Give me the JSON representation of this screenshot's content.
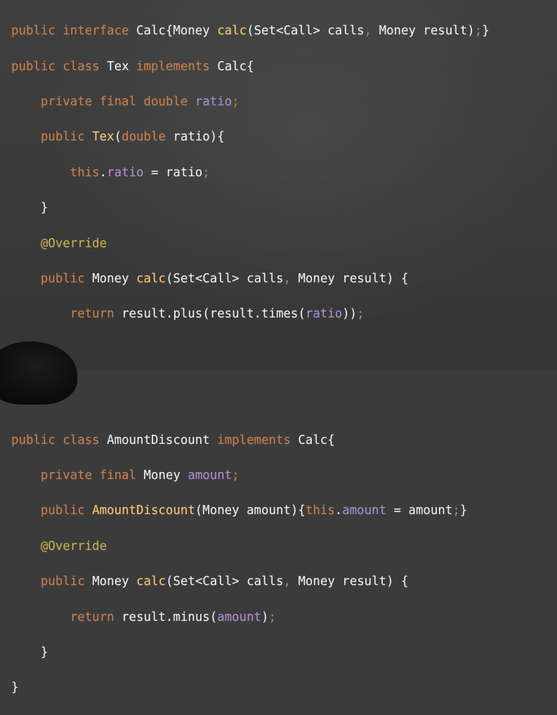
{
  "colors": {
    "background": "#3b3b3b",
    "keyword": "#cc7a44",
    "method": "#ffc66d",
    "field": "#a98bd1",
    "annotation": "#c2b046",
    "text": "#f0f0f0"
  },
  "code": {
    "l1": {
      "kw1": "public interface",
      "id1": "Calc{Money",
      "fn1": "calc",
      "id2": "(Set<Call> calls",
      "p1": ",",
      "id3": "Money result)",
      "p2": ";",
      "id4": "}"
    },
    "l2": {
      "kw1": "public class",
      "id1": "Tex",
      "kw2": "implements",
      "id2": "Calc{"
    },
    "l3": {
      "kw1": "private final double",
      "fd1": "ratio",
      "p1": ";"
    },
    "l4": {
      "kw1": "public",
      "fn1": "Tex",
      "id1": "(",
      "kw2": "double",
      "id2": "ratio){"
    },
    "l5": {
      "kw1": "this",
      "id1": ".",
      "fd1": "ratio",
      "id2": "= ratio",
      "p1": ";"
    },
    "l6": {
      "id1": "}"
    },
    "l7": {
      "an1": "@Override"
    },
    "l8": {
      "kw1": "public",
      "id1": "Money",
      "fn1": "calc",
      "id2": "(Set<Call> calls",
      "p1": ",",
      "id3": "Money result) {"
    },
    "l9": {
      "kw1": "return",
      "id1": "result.plus(result.times(",
      "fd1": "ratio",
      "id2": "))",
      "p1": ";"
    },
    "l10": {
      "id1": "}"
    },
    "l11": {
      "id1": "}"
    },
    "l12": {
      "kw1": "public class",
      "id1": "AmountDiscount",
      "kw2": "implements",
      "id2": "Calc{"
    },
    "l13": {
      "kw1": "private final",
      "id1": "Money",
      "fd1": "amount",
      "p1": ";"
    },
    "l14": {
      "kw1": "public",
      "fn1": "AmountDiscount",
      "id1": "(Money amount){",
      "kw2": "this",
      "id2": ".",
      "fd1": "amount",
      "id3": "= amount",
      "p1": ";",
      "id4": "}"
    },
    "l15": {
      "an1": "@Override"
    },
    "l16": {
      "kw1": "public",
      "id1": "Money",
      "fn1": "calc",
      "id2": "(Set<Call> calls",
      "p1": ",",
      "id3": "Money result) {"
    },
    "l17": {
      "kw1": "return",
      "id1": "result.minus(",
      "fd1": "amount",
      "id2": ")",
      "p1": ";"
    },
    "l18": {
      "id1": "}"
    },
    "l19": {
      "id1": "}"
    }
  }
}
